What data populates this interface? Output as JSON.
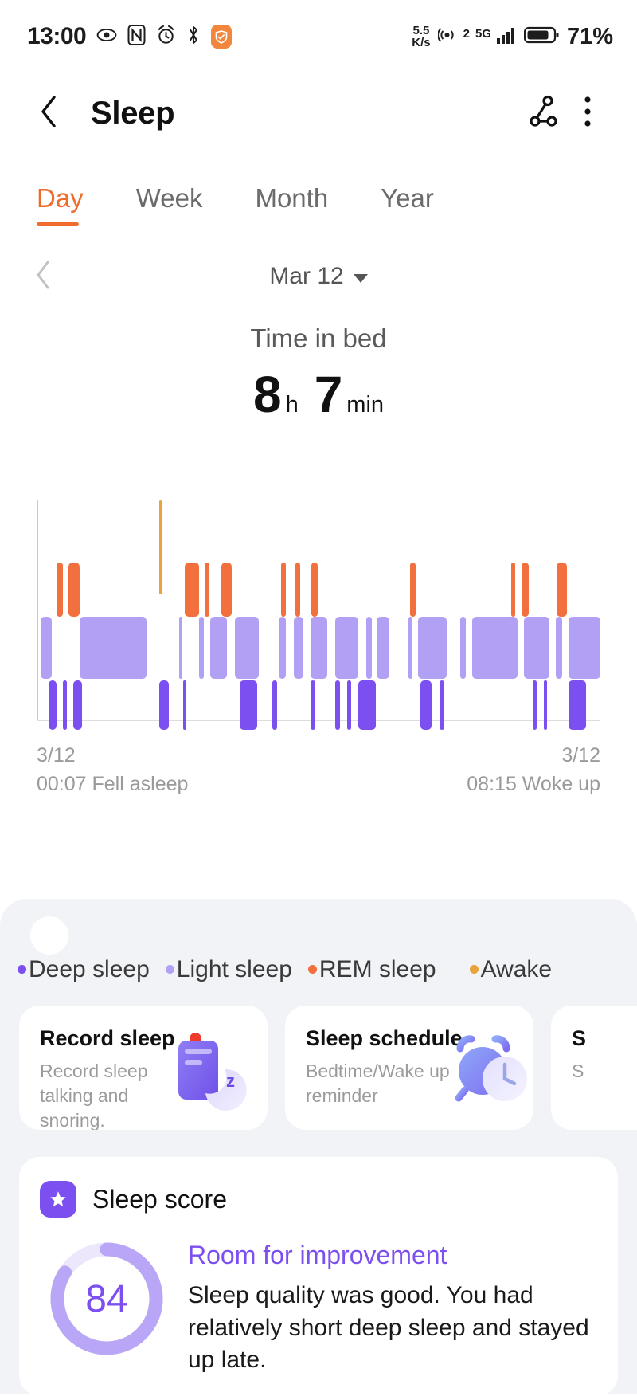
{
  "status_bar": {
    "time": "13:00",
    "net_speed_value": "5.5",
    "net_speed_unit": "K/s",
    "sim_label": "2",
    "network_type": "5G",
    "battery_percent": "71%",
    "icons": [
      "eye-care-icon",
      "nfc-icon",
      "alarm-icon",
      "bluetooth-icon",
      "health-app-icon"
    ]
  },
  "header": {
    "title": "Sleep",
    "back_icon": "back-chevron-icon",
    "share_icon": "share-node-icon",
    "menu_icon": "more-vertical-icon"
  },
  "tabs": [
    {
      "label": "Day",
      "active": true
    },
    {
      "label": "Week",
      "active": false
    },
    {
      "label": "Month",
      "active": false
    },
    {
      "label": "Year",
      "active": false
    }
  ],
  "date_nav": {
    "prev_icon": "chevron-left-icon",
    "label": "Mar 12",
    "dropdown_icon": "caret-down-icon"
  },
  "summary": {
    "label": "Time in bed",
    "hours": "8",
    "hours_unit": "h",
    "minutes": "7",
    "minutes_unit": "min"
  },
  "chart_footer": {
    "start_date": "3/12",
    "start_text": "00:07 Fell asleep",
    "end_date": "3/12",
    "end_text": "08:15 Woke up"
  },
  "legend": [
    {
      "label": "Deep sleep",
      "color": "#7c4ff0"
    },
    {
      "label": "Light sleep",
      "color": "#b2a0f5"
    },
    {
      "label": "REM sleep",
      "color": "#f2703d"
    },
    {
      "label": "Awake",
      "color": "#e8a33d"
    }
  ],
  "feature_cards": [
    {
      "title": "Record sleep",
      "desc": "Record sleep talking and snoring.",
      "badge": "red-dot",
      "icon": "phone-moon-icon"
    },
    {
      "title": "Sleep schedule",
      "desc": "Bedtime/Wake up reminder",
      "badge": "",
      "icon": "alarm-clock-icon"
    },
    {
      "title": "S",
      "desc": "S",
      "badge": "",
      "icon": "partial-card-icon"
    }
  ],
  "sleep_score": {
    "title": "Sleep score",
    "badge_icon": "star-badge-icon",
    "score": "84",
    "verdict": "Room for improvement",
    "description": "Sleep quality was good. You had relatively short deep sleep and stayed up late."
  },
  "chart_data": {
    "type": "bar",
    "title": "Sleep stage hypnogram",
    "xlabel": "",
    "ylabel": "",
    "grid": false,
    "legend_position": "below-chart",
    "x_axis": {
      "start": "00:07",
      "end": "08:15",
      "start_date": "3/12",
      "end_date": "3/12"
    },
    "stage_colors": {
      "awake": "#e8a33d",
      "rem": "#f2703d",
      "light": "#b2a0f5",
      "deep": "#7c4ff0"
    },
    "lanes": [
      "awake",
      "rem",
      "light",
      "deep"
    ],
    "segments": {
      "awake": [
        {
          "start_pct": 21.5,
          "width_pct": 0.5
        }
      ],
      "rem": [
        {
          "start_pct": 3.2,
          "width_pct": 1.2
        },
        {
          "start_pct": 5.4,
          "width_pct": 1.9
        },
        {
          "start_pct": 26.0,
          "width_pct": 2.6
        },
        {
          "start_pct": 29.6,
          "width_pct": 0.8
        },
        {
          "start_pct": 32.6,
          "width_pct": 1.8
        },
        {
          "start_pct": 43.2,
          "width_pct": 0.9
        },
        {
          "start_pct": 45.8,
          "width_pct": 0.8
        },
        {
          "start_pct": 48.6,
          "width_pct": 1.1
        },
        {
          "start_pct": 66.2,
          "width_pct": 0.9
        },
        {
          "start_pct": 84.2,
          "width_pct": 0.7
        },
        {
          "start_pct": 86.0,
          "width_pct": 1.2
        },
        {
          "start_pct": 92.2,
          "width_pct": 1.8
        }
      ],
      "light": [
        {
          "start_pct": 0.4,
          "width_pct": 2.0
        },
        {
          "start_pct": 7.4,
          "width_pct": 11.8
        },
        {
          "start_pct": 25.0,
          "width_pct": 0.7
        },
        {
          "start_pct": 28.6,
          "width_pct": 0.8
        },
        {
          "start_pct": 30.6,
          "width_pct": 3.0
        },
        {
          "start_pct": 35.0,
          "width_pct": 4.2
        },
        {
          "start_pct": 42.8,
          "width_pct": 1.2
        },
        {
          "start_pct": 45.4,
          "width_pct": 1.8
        },
        {
          "start_pct": 48.4,
          "width_pct": 3.0
        },
        {
          "start_pct": 52.8,
          "width_pct": 4.2
        },
        {
          "start_pct": 58.4,
          "width_pct": 1.0
        },
        {
          "start_pct": 60.2,
          "width_pct": 2.2
        },
        {
          "start_pct": 65.8,
          "width_pct": 0.8
        },
        {
          "start_pct": 67.6,
          "width_pct": 5.0
        },
        {
          "start_pct": 75.0,
          "width_pct": 1.0
        },
        {
          "start_pct": 77.2,
          "width_pct": 8.0
        },
        {
          "start_pct": 86.4,
          "width_pct": 4.6
        },
        {
          "start_pct": 92.0,
          "width_pct": 1.2
        },
        {
          "start_pct": 94.4,
          "width_pct": 5.6
        }
      ],
      "deep": [
        {
          "start_pct": 1.8,
          "width_pct": 1.5
        },
        {
          "start_pct": 4.4,
          "width_pct": 0.7
        },
        {
          "start_pct": 6.2,
          "width_pct": 1.6
        },
        {
          "start_pct": 21.6,
          "width_pct": 1.6
        },
        {
          "start_pct": 25.8,
          "width_pct": 0.5
        },
        {
          "start_pct": 35.8,
          "width_pct": 3.2
        },
        {
          "start_pct": 41.6,
          "width_pct": 0.9
        },
        {
          "start_pct": 48.4,
          "width_pct": 0.9
        },
        {
          "start_pct": 52.8,
          "width_pct": 0.9
        },
        {
          "start_pct": 55.0,
          "width_pct": 0.7
        },
        {
          "start_pct": 57.0,
          "width_pct": 3.0
        },
        {
          "start_pct": 68.0,
          "width_pct": 2.0
        },
        {
          "start_pct": 71.4,
          "width_pct": 0.9
        },
        {
          "start_pct": 88.0,
          "width_pct": 0.7
        },
        {
          "start_pct": 90.0,
          "width_pct": 0.5
        },
        {
          "start_pct": 94.4,
          "width_pct": 3.0
        }
      ]
    }
  }
}
